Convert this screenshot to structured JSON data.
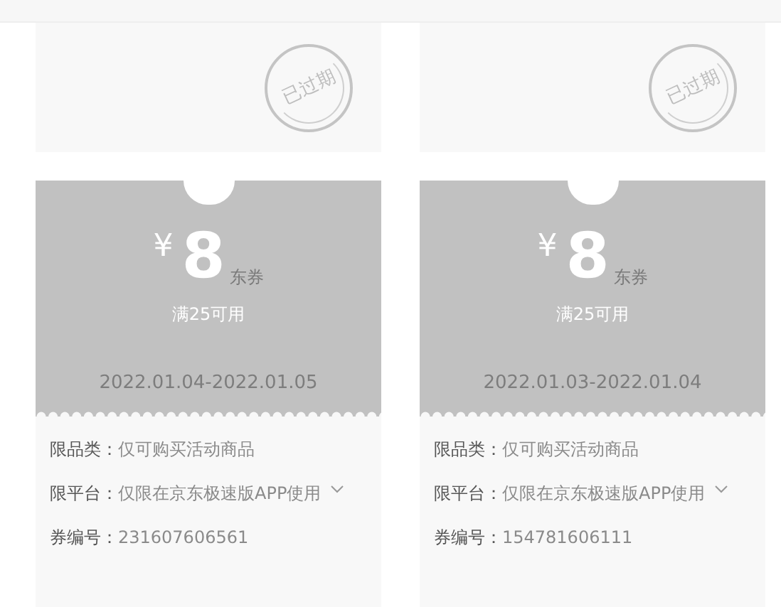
{
  "expired_cards": [
    {
      "stamp": "已过期"
    },
    {
      "stamp": "已过期"
    }
  ],
  "coupons": [
    {
      "currency": "¥",
      "amount": "8",
      "unit": "东券",
      "condition": "满25可用",
      "validity": "2022.01.04-2022.01.05",
      "details": [
        {
          "label": "限品类：",
          "value": "仅可购买活动商品",
          "expandable": false
        },
        {
          "label": "限平台：",
          "value": "仅限在京东极速版APP使用",
          "expandable": true
        },
        {
          "label": "券编号：",
          "value": "231607606561",
          "expandable": false
        }
      ]
    },
    {
      "currency": "¥",
      "amount": "8",
      "unit": "东券",
      "condition": "满25可用",
      "validity": "2022.01.03-2022.01.04",
      "details": [
        {
          "label": "限品类：",
          "value": "仅可购买活动商品",
          "expandable": false
        },
        {
          "label": "限平台：",
          "value": "仅限在京东极速版APP使用",
          "expandable": true
        },
        {
          "label": "券编号：",
          "value": "154781606111",
          "expandable": false
        }
      ]
    }
  ]
}
